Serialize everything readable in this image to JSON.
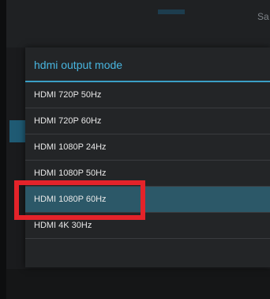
{
  "background": {
    "corner_text": "Sa"
  },
  "dialog": {
    "title": "hdmi output mode",
    "options": [
      {
        "label": "HDMI 720P 50Hz"
      },
      {
        "label": "HDMI 720P 60Hz"
      },
      {
        "label": "HDMI 1080P 24Hz"
      },
      {
        "label": "HDMI 1080P 50Hz"
      },
      {
        "label": "HDMI 1080P 60Hz",
        "selected": true
      },
      {
        "label": "HDMI 4K 30Hz"
      }
    ]
  },
  "colors": {
    "accent": "#48b5df",
    "selected_row": "#2c5868",
    "annotation_box": "#e4232a"
  }
}
